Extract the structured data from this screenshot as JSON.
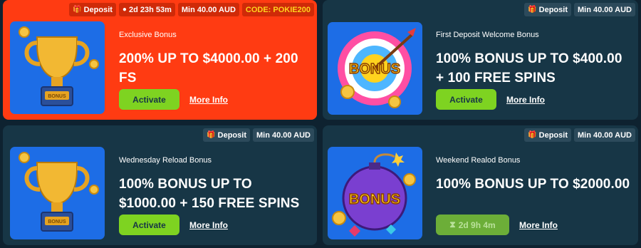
{
  "cards": [
    {
      "subtitle": "Exclusive Bonus",
      "title": "200% UP TO $4000.00 + 200 FS",
      "tags": {
        "deposit": "Deposit",
        "timer": "2d 23h 53m",
        "min": "Min 40.00 AUD",
        "code": "CODE: POKIE200"
      },
      "action": "Activate",
      "more": "More Info",
      "image": "trophy-icon"
    },
    {
      "subtitle": "First Deposit Welcome Bonus",
      "title": "100% BONUS UP TO $400.00 + 100 FREE SPINS",
      "tags": {
        "deposit": "Deposit",
        "min": "Min 40.00 AUD"
      },
      "action": "Activate",
      "more": "More Info",
      "image": "target-bonus-icon"
    },
    {
      "subtitle": "Wednesday Reload Bonus",
      "title": "100% BONUS UP TO $1000.00 + 150 FREE SPINS",
      "tags": {
        "deposit": "Deposit",
        "min": "Min 40.00 AUD"
      },
      "action": "Activate",
      "more": "More Info",
      "image": "trophy-icon"
    },
    {
      "subtitle": "Weekend Realod Bonus",
      "title": "100% BONUS UP TO $2000.00",
      "tags": {
        "deposit": "Deposit",
        "min": "Min 40.00 AUD"
      },
      "action": "2d 9h 4m",
      "more": "More Info",
      "image": "bomb-bonus-icon"
    }
  ],
  "image_text": {
    "bonus": "BONUS"
  },
  "colors": {
    "red_card": "#ff3b12",
    "dark_card": "#173646",
    "button": "#7ed321",
    "code": "#ffd21e"
  }
}
